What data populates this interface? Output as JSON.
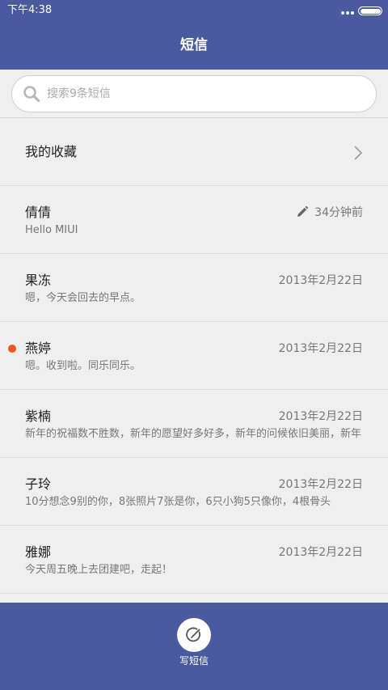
{
  "status_bar": {
    "time": "下午4:38",
    "icons": [
      "more-dots-icon",
      "battery-icon"
    ]
  },
  "header": {
    "title": "短信"
  },
  "search": {
    "icon": "search-icon",
    "placeholder": "搜索9条短信"
  },
  "favorites": {
    "label": "我的收藏",
    "icon": "chevron-right-icon"
  },
  "conversations": [
    {
      "name": "倩倩",
      "preview": "Hello MIUI",
      "time": "34分钟前",
      "draft": true,
      "unread": false
    },
    {
      "name": "果冻",
      "preview": "嗯，今天会回去的早点。",
      "time": "2013年2月22日",
      "draft": false,
      "unread": false
    },
    {
      "name": "燕婷",
      "preview": "嗯。收到啦。同乐同乐。",
      "time": "2013年2月22日",
      "draft": false,
      "unread": true
    },
    {
      "name": "紫楠",
      "preview": "新年的祝福数不胜数，新年的愿望好多好多，新年的问候依旧美丽，新年",
      "time": "2013年2月22日",
      "draft": false,
      "unread": false
    },
    {
      "name": "子玲",
      "preview": "10分想念9别的你，8张照片7张是你，6只小狗5只像你，4根骨头",
      "time": "2013年2月22日",
      "draft": false,
      "unread": false
    },
    {
      "name": "雅娜",
      "preview": "今天周五晚上去团建吧，走起！",
      "time": "2013年2月22日",
      "draft": false,
      "unread": false
    }
  ],
  "bottom_bar": {
    "compose_label": "写短信",
    "compose_icon": "compose-icon"
  },
  "colors": {
    "primary": "#4a5a9e",
    "background": "#efefef",
    "unread_dot": "#f0551f"
  }
}
